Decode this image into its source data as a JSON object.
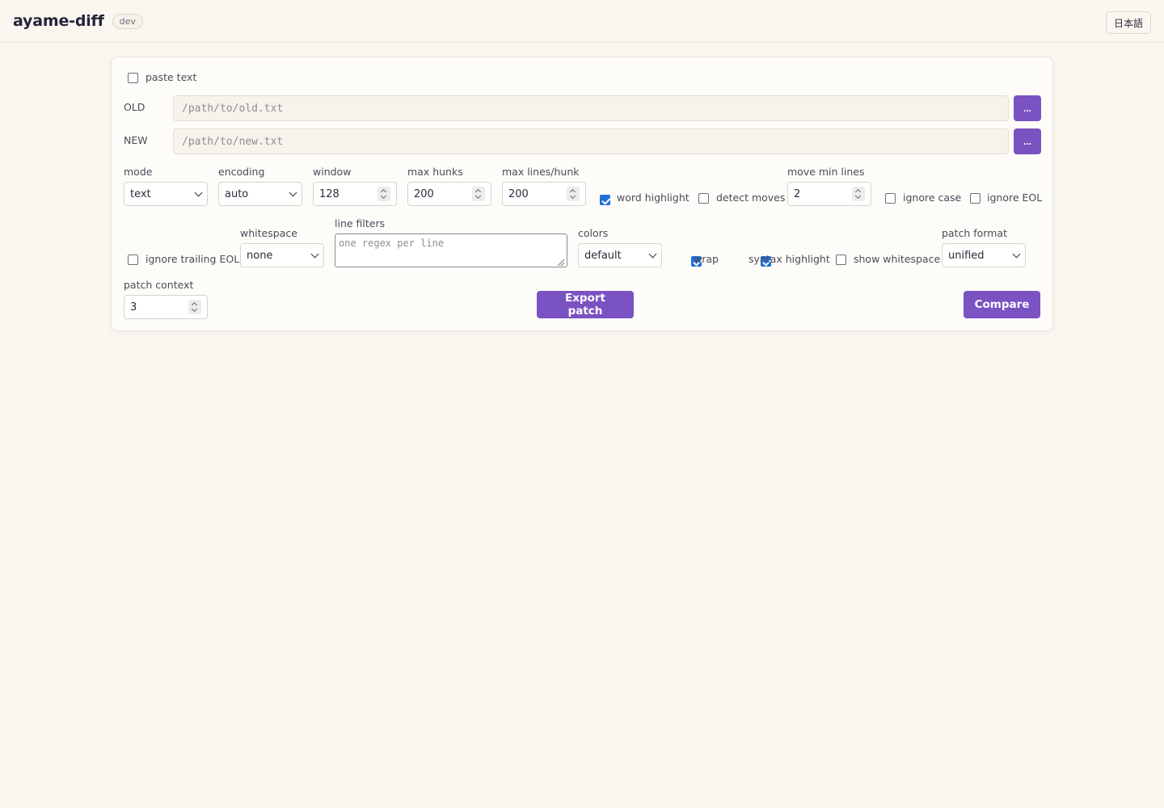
{
  "app": {
    "title": "ayame-diff",
    "badge": "dev",
    "language_button": "日本語"
  },
  "paste_text": {
    "label": "paste text",
    "checked": false
  },
  "old": {
    "label": "OLD",
    "placeholder": "/path/to/old.txt",
    "value": "",
    "browse_label": "..."
  },
  "new": {
    "label": "NEW",
    "placeholder": "/path/to/new.txt",
    "value": "",
    "browse_label": "..."
  },
  "options": {
    "mode": {
      "label": "mode",
      "value": "text"
    },
    "encoding": {
      "label": "encoding",
      "value": "auto"
    },
    "window": {
      "label": "window",
      "value": "128"
    },
    "max_hunks": {
      "label": "max hunks",
      "value": "200"
    },
    "max_lines_hunk": {
      "label": "max lines/hunk",
      "value": "200"
    },
    "word_highlight": {
      "label": "word highlight",
      "checked": true
    },
    "detect_moves": {
      "label": "detect moves",
      "checked": false
    },
    "move_min_lines": {
      "label": "move min lines",
      "value": "2"
    },
    "ignore_case": {
      "label": "ignore case",
      "checked": false
    },
    "ignore_eol": {
      "label": "ignore EOL",
      "checked": false
    },
    "ignore_trailing_eol": {
      "label": "ignore trailing EOL",
      "checked": false
    },
    "whitespace": {
      "label": "whitespace",
      "value": "none"
    },
    "line_filters": {
      "label": "line filters",
      "placeholder": "one regex per line",
      "value": ""
    },
    "colors": {
      "label": "colors",
      "value": "default"
    },
    "wrap": {
      "label": "wrap",
      "checked": true
    },
    "syntax_highlight": {
      "label": "syntax highlight",
      "checked": true
    },
    "show_whitespace": {
      "label": "show whitespace",
      "checked": false
    },
    "patch_format": {
      "label": "patch format",
      "value": "unified"
    },
    "patch_context": {
      "label": "patch context",
      "value": "3"
    }
  },
  "actions": {
    "export_patch": "Export patch",
    "compare": "Compare"
  },
  "colors": {
    "accent": "#7a52c2",
    "checkbox_checked": "#1f6fd8",
    "background": "#faf7f1"
  }
}
